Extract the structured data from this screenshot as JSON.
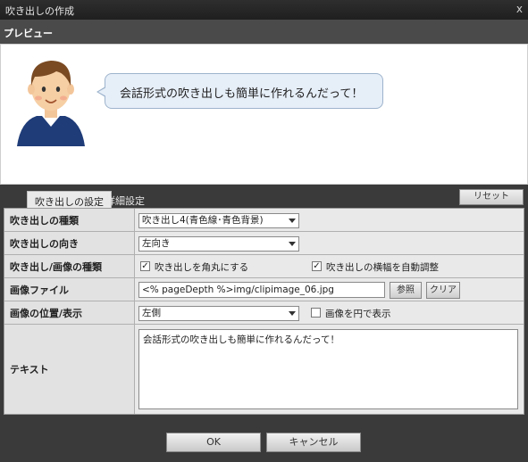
{
  "window": {
    "title": "吹き出しの作成",
    "close": "x"
  },
  "preview": {
    "heading": "プレビュー",
    "bubble_text": "会話形式の吹き出しも簡単に作れるんだって！"
  },
  "tabs": [
    {
      "label": "吹き出しの設定",
      "active": true
    },
    {
      "label": "詳細設定",
      "active": false
    }
  ],
  "reset_label": "リセット",
  "form": {
    "balloon_type": {
      "label": "吹き出しの種類",
      "value": "吹き出し4(青色線･青色背景)"
    },
    "direction": {
      "label": "吹き出しの向き",
      "value": "左向き"
    },
    "image_kind": {
      "label": "吹き出し/画像の種類",
      "rounded": {
        "label": "吹き出しを角丸にする",
        "checked": true
      },
      "auto_width": {
        "label": "吹き出しの横幅を自動調整",
        "checked": true
      }
    },
    "image_file": {
      "label": "画像ファイル",
      "value": "<% pageDepth %>img/clipimage_06.jpg",
      "browse": "参照",
      "clear": "クリア"
    },
    "image_position": {
      "label": "画像の位置/表示",
      "value": "左側",
      "circle": {
        "label": "画像を円で表示",
        "checked": false
      }
    },
    "text": {
      "label": "テキスト",
      "value": "会話形式の吹き出しも簡単に作れるんだって！"
    }
  },
  "buttons": {
    "ok": "OK",
    "cancel": "キャンセル"
  },
  "colors": {
    "bubble_bg": "#e6eef8",
    "bubble_border": "#9db3cc",
    "dark_bg": "#3a3a3a"
  }
}
